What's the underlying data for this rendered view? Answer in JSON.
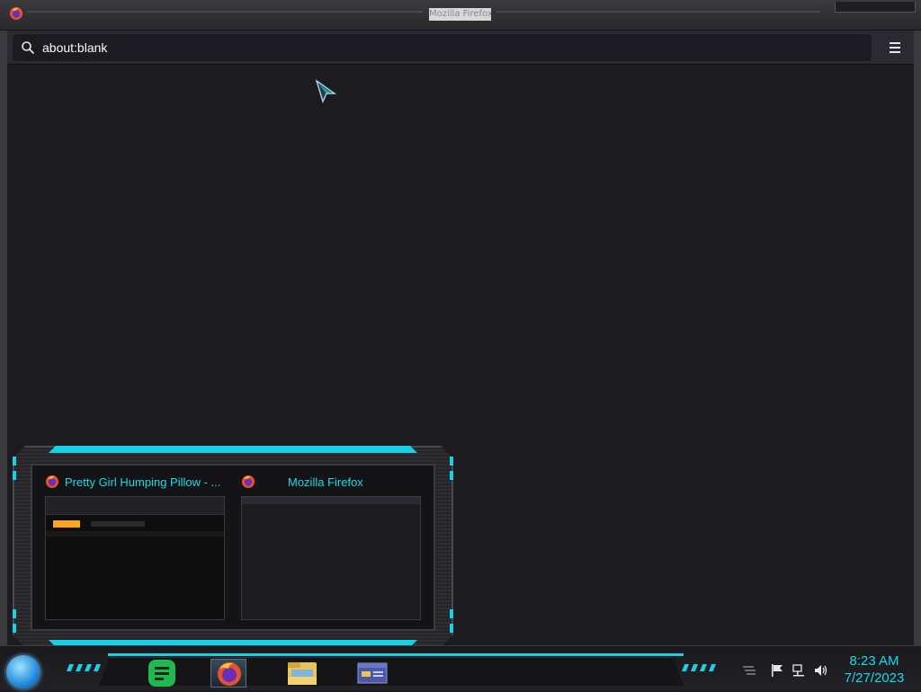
{
  "window": {
    "title": "Mozilla Firefox"
  },
  "toolbar": {
    "url": "about:blank",
    "search_icon": "search-icon",
    "menu_icon": "hamburger-menu-icon"
  },
  "preview": {
    "windows": [
      {
        "title": "Pretty Girl Humping Pillow - ...",
        "icon": "firefox-icon"
      },
      {
        "title": "Mozilla Firefox",
        "icon": "firefox-icon"
      }
    ]
  },
  "taskbar": {
    "start_icon": "start-orb-icon",
    "apps": [
      {
        "name": "Notes",
        "icon": "notes-app-icon"
      },
      {
        "name": "Firefox",
        "icon": "firefox-icon",
        "active": true
      },
      {
        "name": "File Explorer",
        "icon": "folder-icon"
      },
      {
        "name": "Window Manager",
        "icon": "window-app-icon"
      }
    ]
  },
  "tray": {
    "icons": [
      "show-desktop-icon",
      "flag-icon",
      "network-icon",
      "volume-icon"
    ],
    "time": "8:23 AM",
    "date": "7/27/2023"
  },
  "colors": {
    "accent": "#1ad0e6",
    "background": "#1c1b1f",
    "toolbar": "#2b2a33"
  }
}
